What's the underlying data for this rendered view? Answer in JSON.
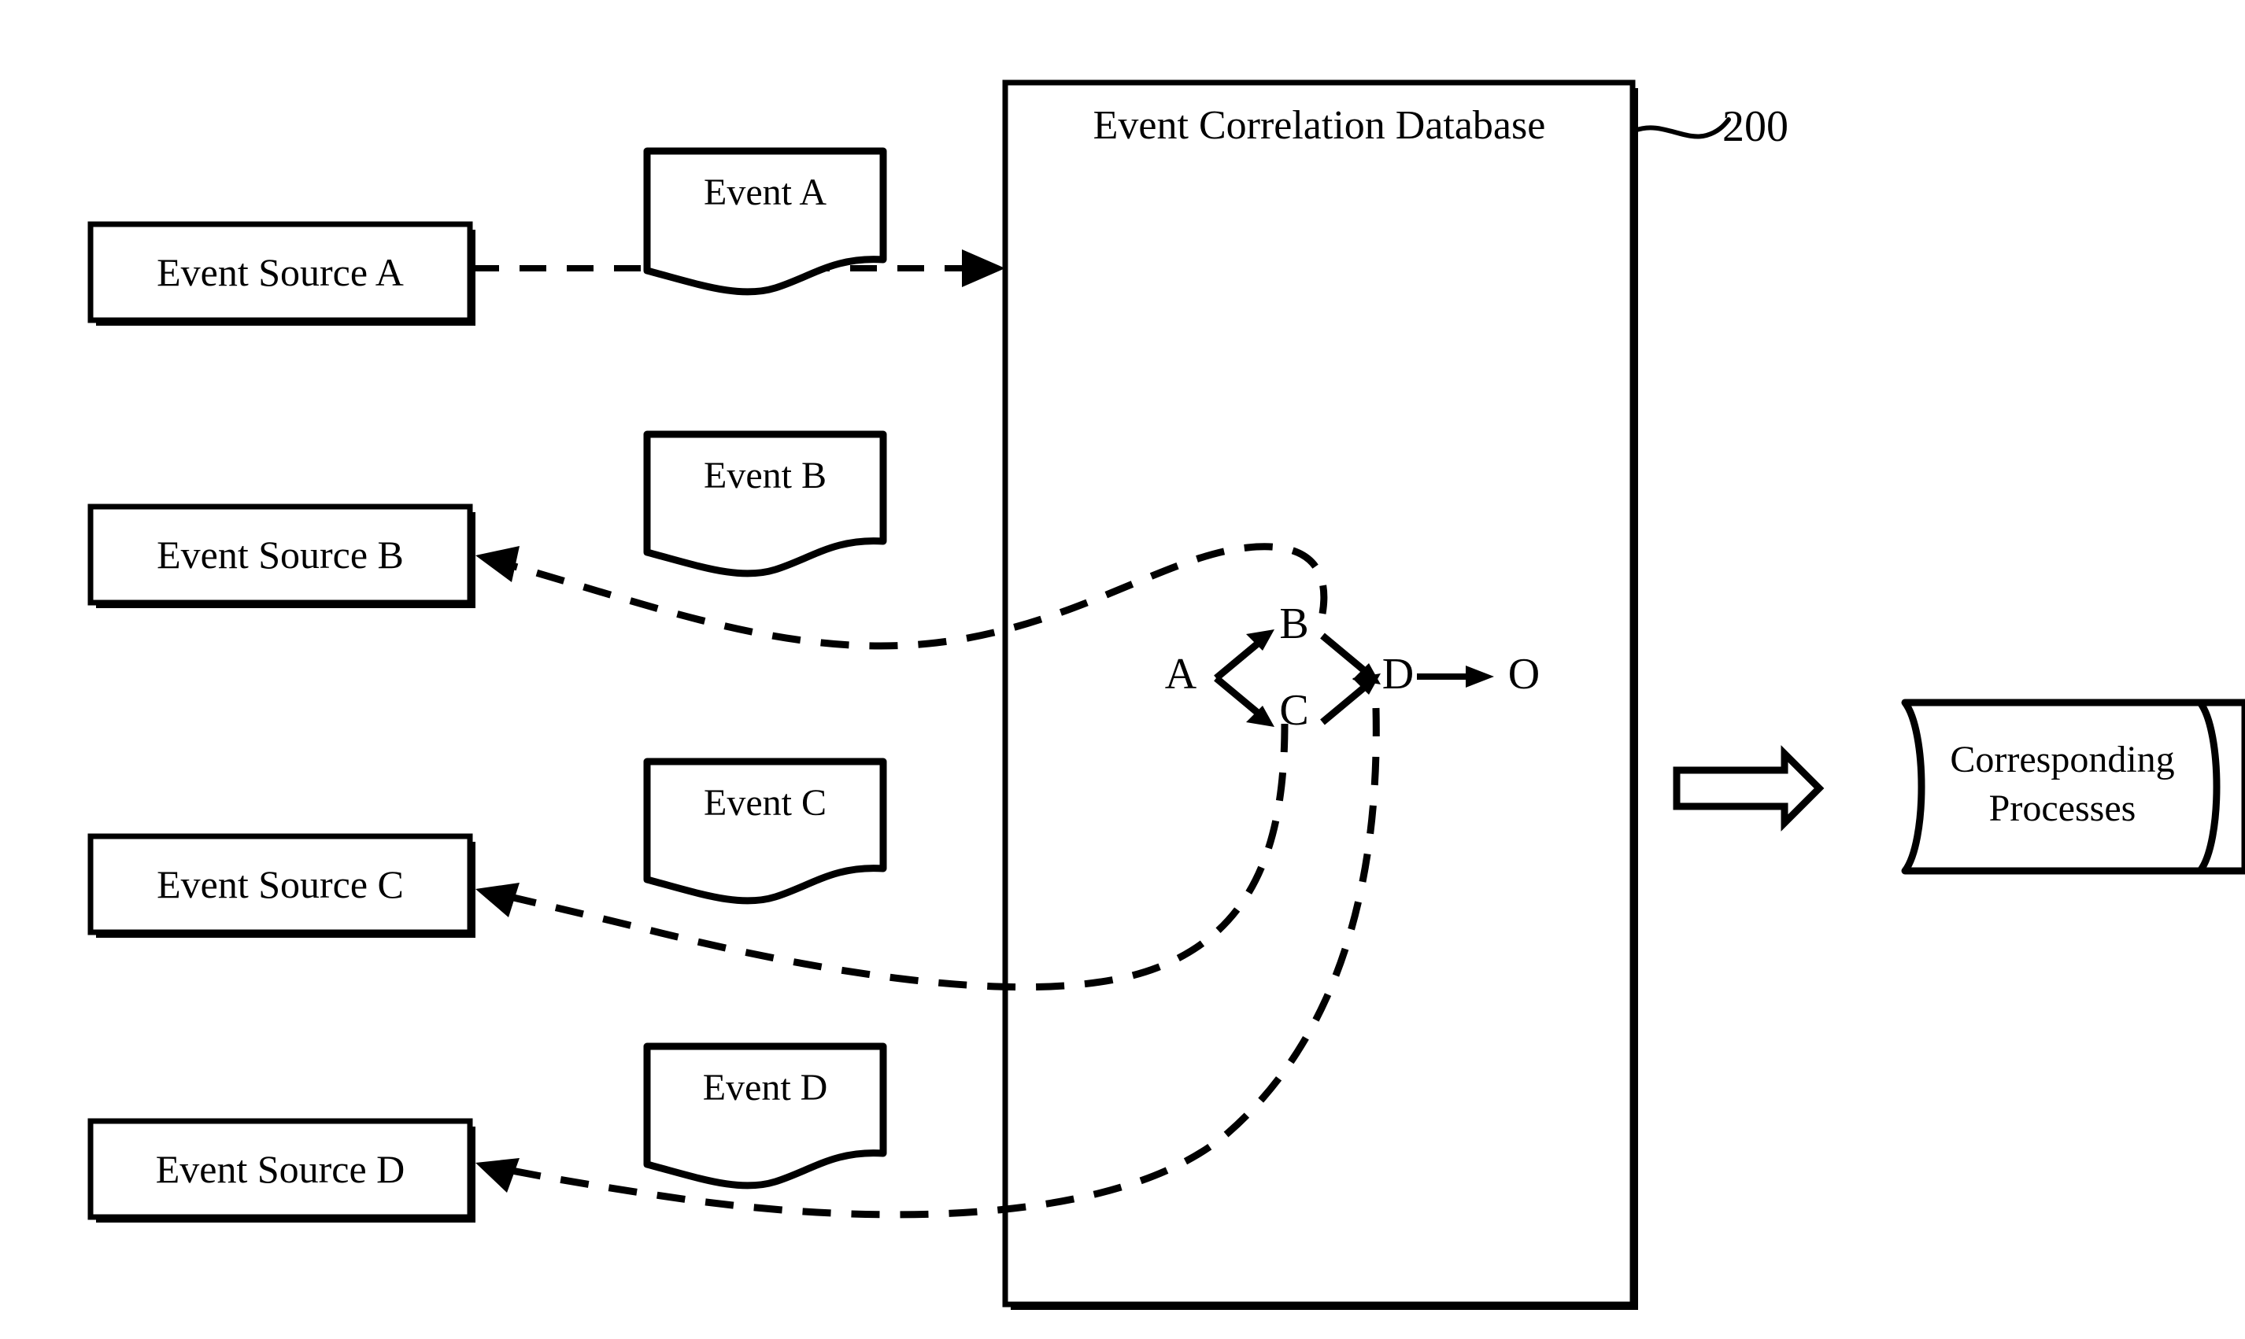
{
  "figure": {
    "title_label": "Event Correlation Database",
    "reference_numeral": "200"
  },
  "sources": [
    {
      "id": "a",
      "label": "Event Source A"
    },
    {
      "id": "b",
      "label": "Event Source B"
    },
    {
      "id": "c",
      "label": "Event Source C"
    },
    {
      "id": "d",
      "label": "Event Source D"
    }
  ],
  "event_documents": [
    {
      "id": "a",
      "label": "Event A"
    },
    {
      "id": "b",
      "label": "Event B"
    },
    {
      "id": "c",
      "label": "Event C"
    },
    {
      "id": "d",
      "label": "Event D"
    }
  ],
  "correlation_graph": {
    "nodes": [
      {
        "id": "A",
        "label": "A"
      },
      {
        "id": "B",
        "label": "B"
      },
      {
        "id": "C",
        "label": "C"
      },
      {
        "id": "D",
        "label": "D"
      },
      {
        "id": "O",
        "label": "O"
      }
    ],
    "edges": [
      {
        "from": "A",
        "to": "B"
      },
      {
        "from": "A",
        "to": "C"
      },
      {
        "from": "B",
        "to": "D"
      },
      {
        "from": "C",
        "to": "D"
      },
      {
        "from": "D",
        "to": "O"
      }
    ]
  },
  "output": {
    "cylinder_line1": "Corresponding",
    "cylinder_line2": "Processes"
  },
  "colors": {
    "stroke": "#000000",
    "fill": "#ffffff",
    "background": "#ffffff"
  }
}
